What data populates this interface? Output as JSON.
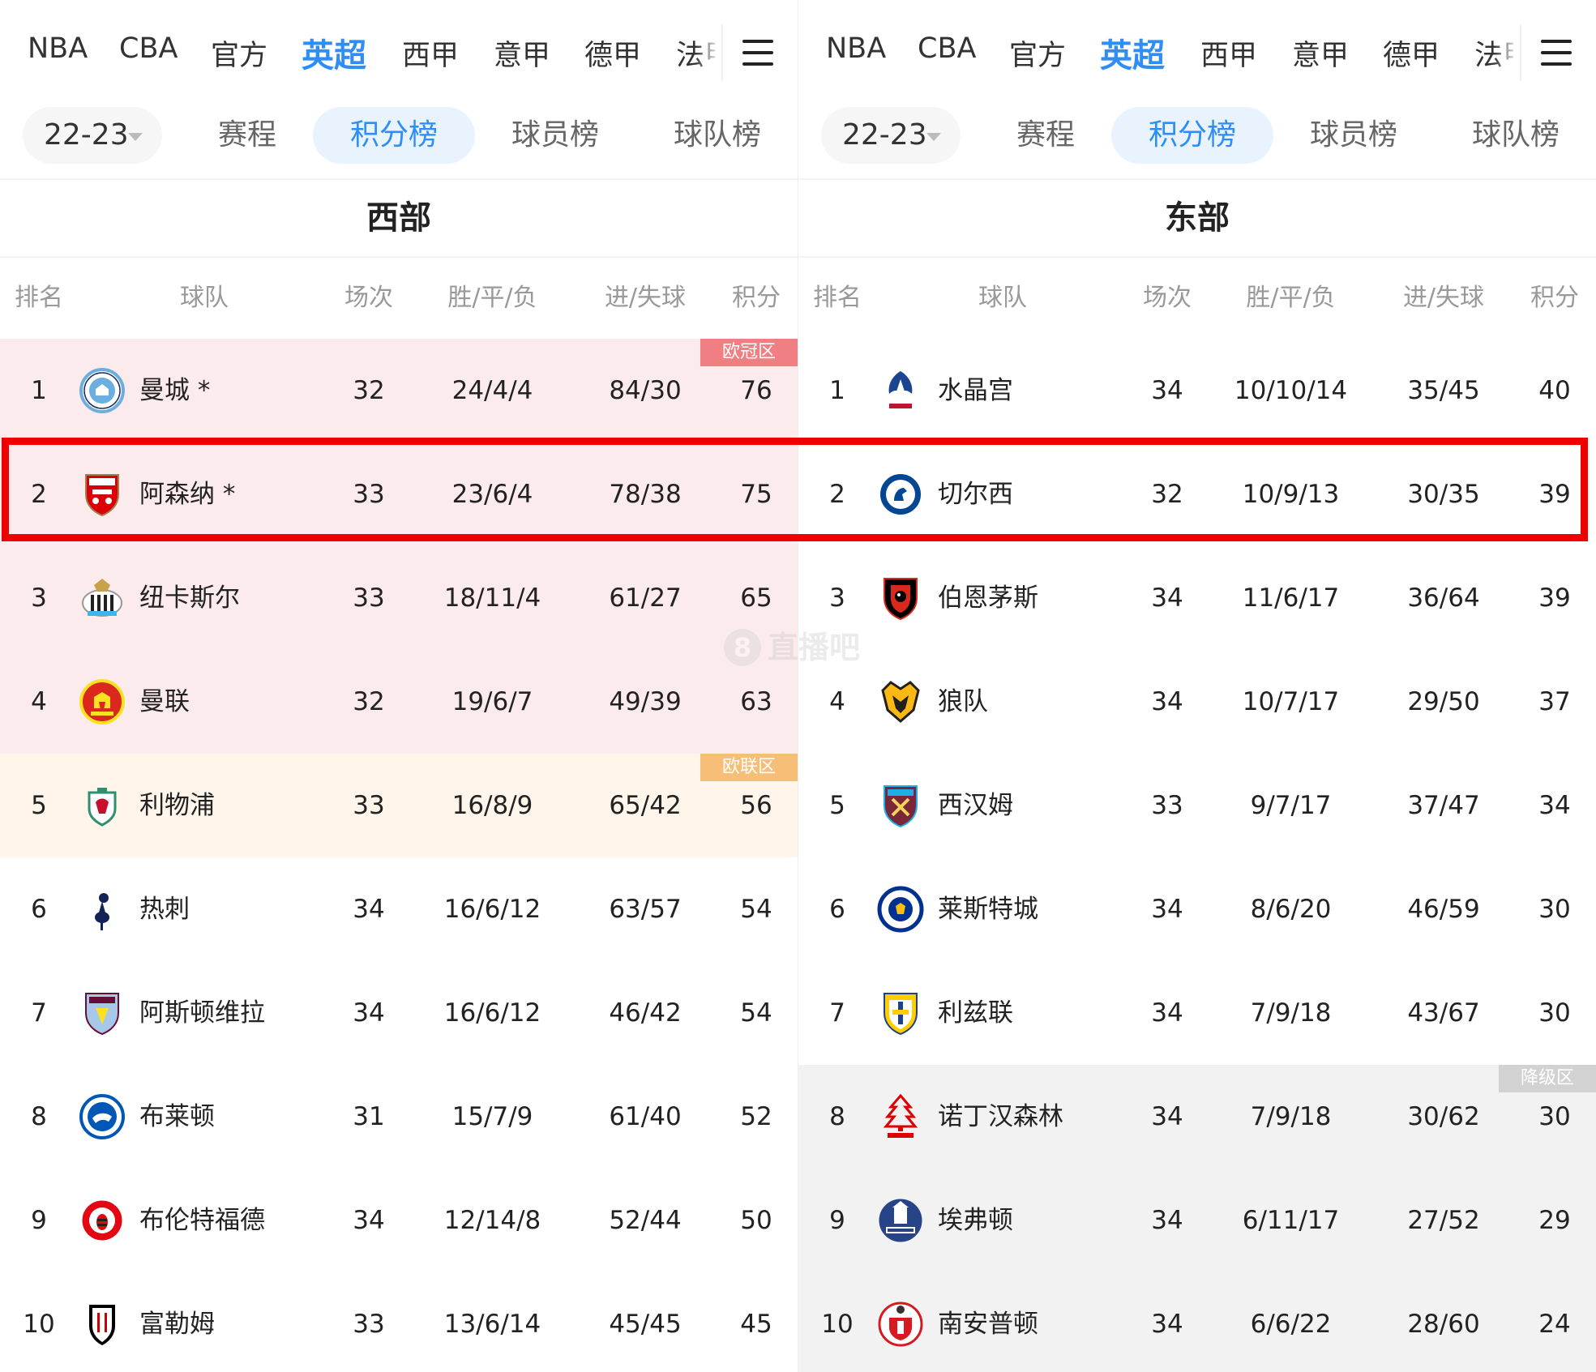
{
  "nav": {
    "tabs": [
      "NBA",
      "CBA",
      "官方",
      "英超",
      "西甲",
      "意甲",
      "德甲",
      "法甲"
    ],
    "active": "英超"
  },
  "subnav": {
    "season": "22-23",
    "items": [
      "赛程",
      "积分榜",
      "球员榜",
      "球队榜"
    ],
    "active": "积分榜"
  },
  "table_headers": [
    "排名",
    "球队",
    "场次",
    "胜/平/负",
    "进/失球",
    "积分"
  ],
  "zones": {
    "ucl": "欧冠区",
    "uel": "欧联区",
    "rel": "降级区"
  },
  "colors": {
    "accent": "#2f8ef5",
    "highlight_border": "#ee0000",
    "ucl_bg": "#fcebed",
    "uel_bg": "#fff5ea",
    "rel_bg": "#f2f2f2"
  },
  "watermark": {
    "glyph": "8",
    "text": "直播吧"
  },
  "left": {
    "conference": "西部",
    "rows": [
      {
        "rank": "1",
        "team": "曼城 *",
        "crest": "man-city-crest",
        "played": "32",
        "wdl": "24/4/4",
        "goals": "84/30",
        "pts": "76",
        "zone": "ucl",
        "badge": "欧冠区"
      },
      {
        "rank": "2",
        "team": "阿森纳 *",
        "crest": "arsenal-crest",
        "played": "33",
        "wdl": "23/6/4",
        "goals": "78/38",
        "pts": "75",
        "zone": "ucl"
      },
      {
        "rank": "3",
        "team": "纽卡斯尔",
        "crest": "newcastle-crest",
        "played": "33",
        "wdl": "18/11/4",
        "goals": "61/27",
        "pts": "65",
        "zone": "ucl"
      },
      {
        "rank": "4",
        "team": "曼联",
        "crest": "man-united-crest",
        "played": "32",
        "wdl": "19/6/7",
        "goals": "49/39",
        "pts": "63",
        "zone": "ucl"
      },
      {
        "rank": "5",
        "team": "利物浦",
        "crest": "liverpool-crest",
        "played": "33",
        "wdl": "16/8/9",
        "goals": "65/42",
        "pts": "56",
        "zone": "uel",
        "badge": "欧联区"
      },
      {
        "rank": "6",
        "team": "热刺",
        "crest": "tottenham-crest",
        "played": "34",
        "wdl": "16/6/12",
        "goals": "63/57",
        "pts": "54",
        "zone": ""
      },
      {
        "rank": "7",
        "team": "阿斯顿维拉",
        "crest": "aston-villa-crest",
        "played": "34",
        "wdl": "16/6/12",
        "goals": "46/42",
        "pts": "54",
        "zone": ""
      },
      {
        "rank": "8",
        "team": "布莱顿",
        "crest": "brighton-crest",
        "played": "31",
        "wdl": "15/7/9",
        "goals": "61/40",
        "pts": "52",
        "zone": ""
      },
      {
        "rank": "9",
        "team": "布伦特福德",
        "crest": "brentford-crest",
        "played": "34",
        "wdl": "12/14/8",
        "goals": "52/44",
        "pts": "50",
        "zone": ""
      },
      {
        "rank": "10",
        "team": "富勒姆",
        "crest": "fulham-crest",
        "played": "33",
        "wdl": "13/6/14",
        "goals": "45/45",
        "pts": "45",
        "zone": ""
      }
    ]
  },
  "right": {
    "conference": "东部",
    "rows": [
      {
        "rank": "1",
        "team": "水晶宫",
        "crest": "crystal-palace-crest",
        "played": "34",
        "wdl": "10/10/14",
        "goals": "35/45",
        "pts": "40",
        "zone": ""
      },
      {
        "rank": "2",
        "team": "切尔西",
        "crest": "chelsea-crest",
        "played": "32",
        "wdl": "10/9/13",
        "goals": "30/35",
        "pts": "39",
        "zone": ""
      },
      {
        "rank": "3",
        "team": "伯恩茅斯",
        "crest": "bournemouth-crest",
        "played": "34",
        "wdl": "11/6/17",
        "goals": "36/64",
        "pts": "39",
        "zone": ""
      },
      {
        "rank": "4",
        "team": "狼队",
        "crest": "wolves-crest",
        "played": "34",
        "wdl": "10/7/17",
        "goals": "29/50",
        "pts": "37",
        "zone": ""
      },
      {
        "rank": "5",
        "team": "西汉姆",
        "crest": "west-ham-crest",
        "played": "33",
        "wdl": "9/7/17",
        "goals": "37/47",
        "pts": "34",
        "zone": ""
      },
      {
        "rank": "6",
        "team": "莱斯特城",
        "crest": "leicester-crest",
        "played": "34",
        "wdl": "8/6/20",
        "goals": "46/59",
        "pts": "30",
        "zone": ""
      },
      {
        "rank": "7",
        "team": "利兹联",
        "crest": "leeds-crest",
        "played": "34",
        "wdl": "7/9/18",
        "goals": "43/67",
        "pts": "30",
        "zone": ""
      },
      {
        "rank": "8",
        "team": "诺丁汉森林",
        "crest": "nottingham-forest-crest",
        "played": "34",
        "wdl": "7/9/18",
        "goals": "30/62",
        "pts": "30",
        "zone": "rel",
        "badge": "降级区"
      },
      {
        "rank": "9",
        "team": "埃弗顿",
        "crest": "everton-crest",
        "played": "34",
        "wdl": "6/11/17",
        "goals": "27/52",
        "pts": "29",
        "zone": "rel"
      },
      {
        "rank": "10",
        "team": "南安普顿",
        "crest": "southampton-crest",
        "played": "34",
        "wdl": "6/6/22",
        "goals": "28/60",
        "pts": "24",
        "zone": "rel"
      }
    ]
  }
}
